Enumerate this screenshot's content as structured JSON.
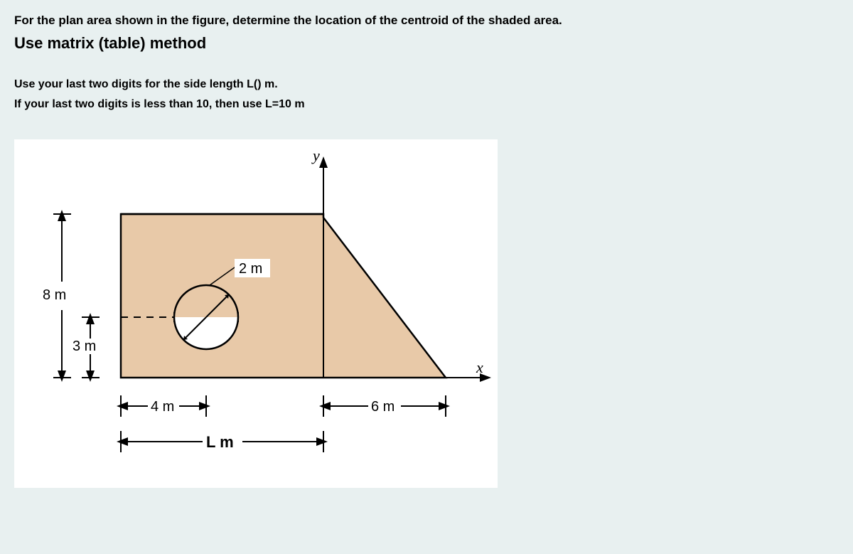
{
  "problem_text": "For the plan area shown in the figure, determine the location of the centroid of the shaded area.",
  "method_heading": "Use matrix (table) method",
  "instruction_1": "Use your last two digits for the side length L() m.",
  "instruction_2": "If your last two digits is less than 10, then use L=10 m",
  "figure": {
    "dim_8m": "8 m",
    "dim_3m": "3 m",
    "dim_2m": "2 m",
    "dim_4m": "4 m",
    "dim_6m": "6 m",
    "dim_Lm": "L m",
    "axis_y": "y",
    "axis_x": "x"
  }
}
